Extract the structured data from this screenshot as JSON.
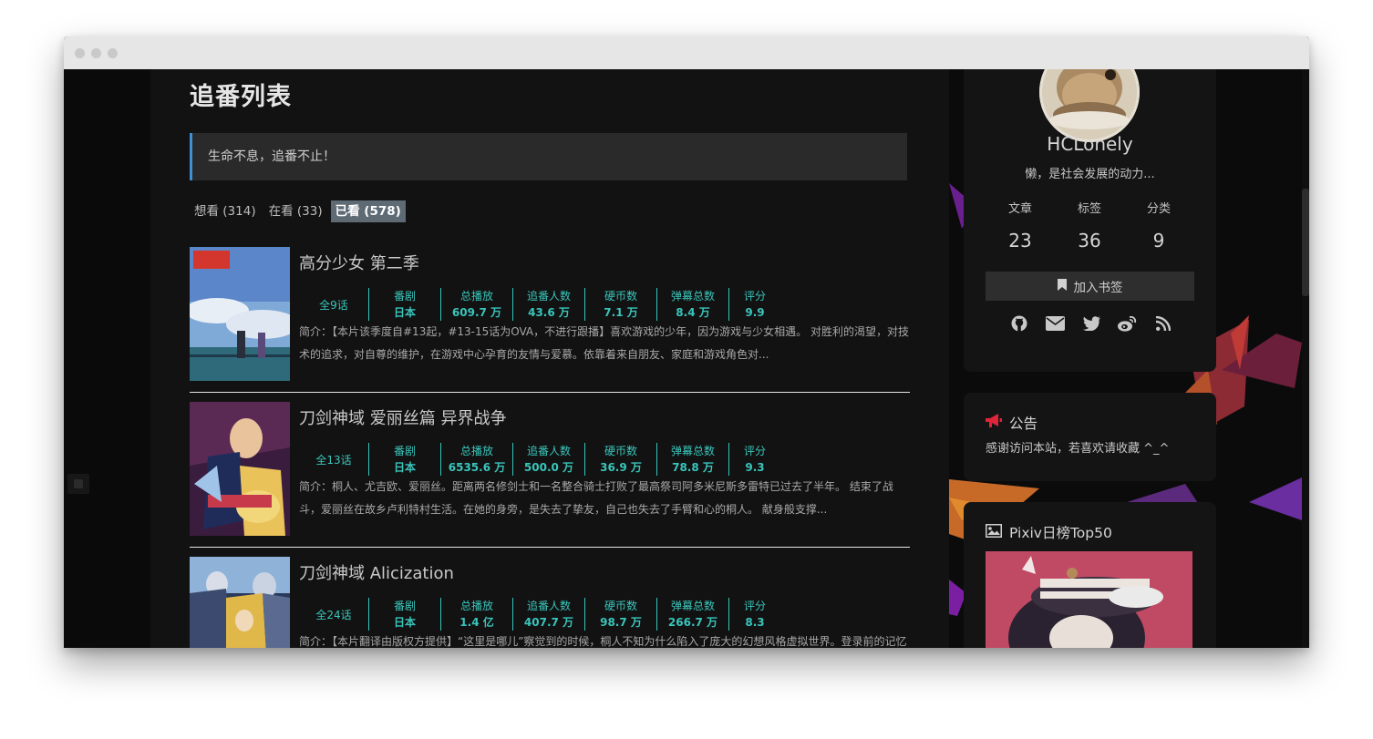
{
  "page": {
    "title": "追番列表",
    "quote": "生命不息，追番不止！",
    "tabs": [
      {
        "label": "想看 (314)",
        "active": false
      },
      {
        "label": "在看 (33)",
        "active": false
      },
      {
        "label": "已看 (578)",
        "active": true
      }
    ],
    "stat_labels": {
      "area": "番剧",
      "play": "总播放",
      "follow": "追番人数",
      "coin": "硬币数",
      "danmaku": "弹幕总数",
      "score": "评分"
    }
  },
  "items": [
    {
      "title": "高分少女 第二季",
      "episodes": "全9话",
      "area": "日本",
      "play": "609.7 万",
      "follow": "43.6 万",
      "coin": "7.1 万",
      "danmaku": "8.4 万",
      "score": "9.9",
      "desc": "简介：【本片该季度自#13起，#13-15话为OVA，不进行跟播】喜欢游戏的少年，因为游戏与少女相遇。 对胜利的渴望，对技术的追求，对自尊的维护，在游戏中心孕育的友情与爱慕。依靠着来自朋友、家庭和游戏角色对..."
    },
    {
      "title": "刀剑神域 爱丽丝篇 异界战争",
      "episodes": "全13话",
      "area": "日本",
      "play": "6535.6 万",
      "follow": "500.0 万",
      "coin": "36.9 万",
      "danmaku": "78.8 万",
      "score": "9.3",
      "desc": "简介：桐人、尤吉欧、爱丽丝。距离两名修剑士和一名整合骑士打败了最高祭司阿多米尼斯多雷特已过去了半年。 结束了战斗，爱丽丝在故乡卢利特村生活。在她的身旁，是失去了挚友，自己也失去了手臂和心的桐人。 献身般支撑..."
    },
    {
      "title": "刀剑神域 Alicization",
      "episodes": "全24话",
      "area": "日本",
      "play": "1.4 亿",
      "follow": "407.7 万",
      "coin": "98.7 万",
      "danmaku": "266.7 万",
      "score": "8.3",
      "desc": "简介：【本片翻译由版权方提供】“这里是哪儿”察觉到的时候，桐人不知为什么陷入了庞大的幻想风格虚拟世界。登录前的记忆"
    }
  ],
  "sidebar": {
    "author_name": "HCLonely",
    "author_desc": "懒，是社会发展的动力...",
    "counters": [
      {
        "label": "文章",
        "value": "23"
      },
      {
        "label": "标签",
        "value": "36"
      },
      {
        "label": "分类",
        "value": "9"
      }
    ],
    "bookmark_label": "加入书签",
    "socials": [
      "github-icon",
      "email-icon",
      "twitter-icon",
      "weibo-icon",
      "rss-icon"
    ],
    "announce_title": "公告",
    "announce_text": "感谢访问本站，若喜欢请收藏 ^_^",
    "pixiv_title": "Pixiv日榜Top50"
  },
  "colors": {
    "accent": "#39c5bb",
    "quote_border": "#3d8fd6",
    "announce_icon": "#e0243a",
    "active_tab": "#5e6b75"
  }
}
